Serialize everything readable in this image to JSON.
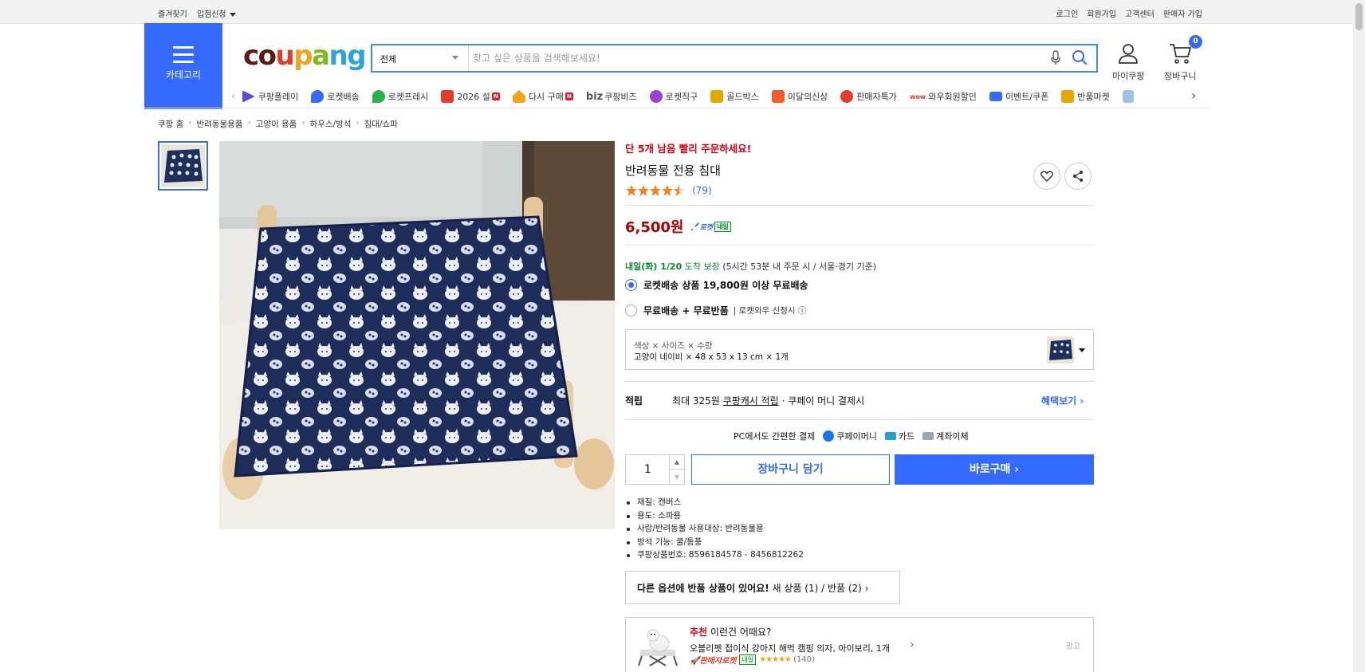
{
  "topbar": {
    "left": [
      "즐겨찾기",
      "입점신청"
    ],
    "right": [
      "로그인",
      "회원가입",
      "고객센터",
      "판매자 가입"
    ]
  },
  "header": {
    "category_label": "카테고리",
    "logo": {
      "c": "c",
      "o": "o",
      "u": "u",
      "p": "p",
      "a": "a",
      "n": "n",
      "g": "g"
    },
    "search": {
      "scope": "전체",
      "placeholder": "찾고 싶은 상품을 검색해보세요!"
    },
    "mypage_label": "마이쿠팡",
    "cart_label": "장바구니",
    "cart_count": "0"
  },
  "nav": [
    {
      "label": "쿠팡플레이",
      "color": "#5b4bdb"
    },
    {
      "label": "로켓배송",
      "color": "#346aff"
    },
    {
      "label": "로켓프레시",
      "color": "#2ab24b"
    },
    {
      "label": "2026 설",
      "color": "#e43b2a",
      "new": "N"
    },
    {
      "label": "다시 구매",
      "color": "#f5a21b",
      "new": "N"
    },
    {
      "label": "쿠팡비즈",
      "prefix": "biz",
      "color": "#555555"
    },
    {
      "label": "로켓직구",
      "color": "#9b3fd6"
    },
    {
      "label": "골드박스",
      "color": "#e6a800"
    },
    {
      "label": "이달의신상",
      "color": "#ef5a2f"
    },
    {
      "label": "판매자특가",
      "color": "#e43b2a"
    },
    {
      "label": "와우회원할인",
      "color": "#e43b2a",
      "prefix": "wow"
    },
    {
      "label": "이벤트/쿠폰",
      "color": "#346aff"
    },
    {
      "label": "반품마켓",
      "color": "#e6a800"
    }
  ],
  "breadcrumb": [
    "쿠팡 홈",
    "반려동물용품",
    "고양이 용품",
    "하우스/방석",
    "침대/쇼파"
  ],
  "product": {
    "urgent": "단 5개 남음 빨리 주문하세요!",
    "title": "반려동물 전용 침대",
    "rating": 4.5,
    "review_count": "(79)",
    "price": "6,500원",
    "rocket_label": "로켓",
    "rocket_badge": "내일",
    "delivery_date": "내일(화) 1/20",
    "delivery_guarantee": "도착 보장",
    "delivery_note": "(5시간 53분 내 주문 시 / 서울·경기 기준)",
    "ship_option_1": "로켓배송 상품 19,800원 이상 무료배송",
    "ship_option_2": "무료배송 + 무료반품",
    "ship_option_2_sub": "로켓와우 신청시 ⓘ",
    "option_header": "색상 × 사이즈 × 수량",
    "option_value": "고양이 네이비 × 48 x 53 x 13 cm × 1개",
    "reward_key": "적립",
    "reward_pre": "최대 325원",
    "reward_link_text": "쿠팡캐시 적립",
    "reward_post": "· 쿠페이 머니 결제시",
    "reward_more": "혜택보기 ›",
    "pay_title": "PC에서도 간편한 결제",
    "pay_methods": [
      "쿠페이머니",
      "카드",
      "계좌이체"
    ],
    "quantity": "1",
    "cart_button": "장바구니 담기",
    "buy_button": "바로구매 ›",
    "specs": [
      "재질: 캔버스",
      "용도: 소파용",
      "사람/반려동물 사용대상: 반려동물용",
      "방석 기능: 쿨/통풍",
      "쿠팡상품번호: 8596184578 - 8456812262"
    ],
    "return_bold": "다른 옵션에 반품 상품이 있어요!",
    "return_rest": "새 상품 (1) / 반품 (2) ›"
  },
  "reco": {
    "tag": "추천",
    "headline": "이런건 어때요?",
    "item_title": "오블리펫 접이식 강아지 해먹 캠핑 의자, 아이보리, 1개",
    "seller_label": "판매자로켓",
    "badge": "내일",
    "stars": "★★★★★",
    "reviews": "(140)",
    "ad": "광고"
  },
  "colors": {
    "accent": "#346aff",
    "price": "#ae0000",
    "urgent": "#d8000c",
    "green": "#0a8a2e"
  }
}
